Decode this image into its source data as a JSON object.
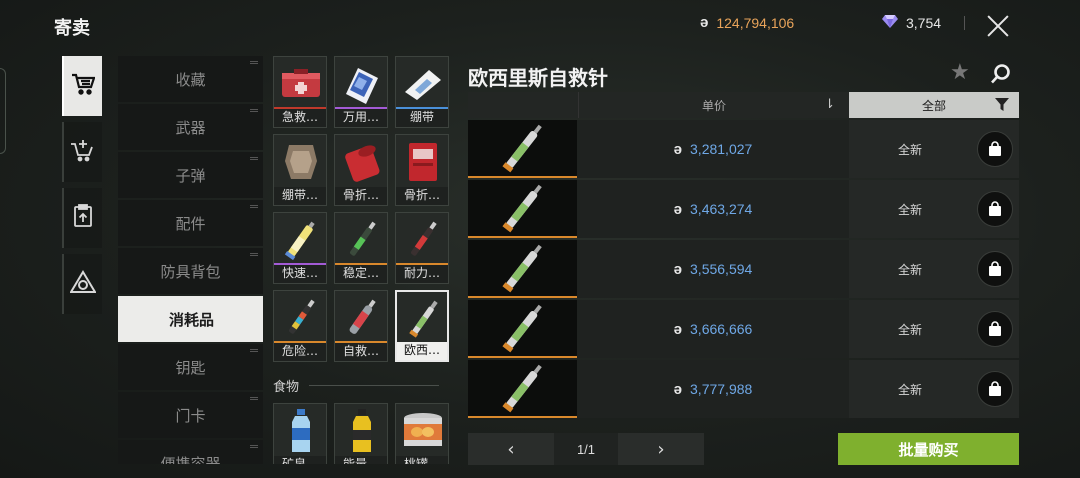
{
  "header": {
    "title": "寄卖",
    "koen_symbol": "ə",
    "koen_balance": "124,794,106",
    "gem_balance": "3,754"
  },
  "side_nav": {
    "icons": [
      "cart-icon",
      "cart-add-icon",
      "clipboard-upload-icon",
      "triangle-logo-icon"
    ],
    "active_index": 0
  },
  "categories": [
    {
      "label": "收藏"
    },
    {
      "label": "武器"
    },
    {
      "label": "子弹"
    },
    {
      "label": "配件"
    },
    {
      "label": "防具背包"
    },
    {
      "label": "消耗品"
    },
    {
      "label": "钥匙"
    },
    {
      "label": "门卡"
    },
    {
      "label": "便携容器"
    }
  ],
  "active_category": "消耗品",
  "medical_items": [
    {
      "label": "急救…",
      "icon": "red-medkit-icon",
      "bar": "#c0392b"
    },
    {
      "label": "万用…",
      "icon": "blue-pouch-icon",
      "bar": "#a35bd6"
    },
    {
      "label": "绷带",
      "icon": "white-bandage-icon",
      "bar": "#4a90d9"
    },
    {
      "label": "绷带…",
      "icon": "tan-bandage-icon",
      "bar": ""
    },
    {
      "label": "骨折…",
      "icon": "red-splint-roll-icon",
      "bar": ""
    },
    {
      "label": "骨折…",
      "icon": "red-splint-pack-icon",
      "bar": ""
    },
    {
      "label": "快速…",
      "icon": "yellow-syringe-icon",
      "bar": "#a35bd6"
    },
    {
      "label": "稳定…",
      "icon": "green-syringe-icon",
      "bar": "#d9882c"
    },
    {
      "label": "耐力…",
      "icon": "red-syringe-icon",
      "bar": "#d9882c"
    },
    {
      "label": "危险…",
      "icon": "multicolor-syringe-icon",
      "bar": "#d9882c"
    },
    {
      "label": "自救…",
      "icon": "red-tube-syringe-icon",
      "bar": "#d9882c"
    },
    {
      "label": "欧西…",
      "icon": "ossi-syringe-icon",
      "bar": ""
    }
  ],
  "selected_item_index": 11,
  "food_section": {
    "heading": "食物",
    "items": [
      {
        "label": "矿泉…",
        "icon": "water-bottle-icon"
      },
      {
        "label": "能量…",
        "icon": "energy-drink-icon"
      },
      {
        "label": "桃罐…",
        "icon": "peach-can-icon"
      }
    ]
  },
  "detail": {
    "title": "欧西里斯自救针",
    "price_header": "单价",
    "filter_label": "全部"
  },
  "listings": [
    {
      "price": "3,281,027",
      "condition": "全新"
    },
    {
      "price": "3,463,274",
      "condition": "全新"
    },
    {
      "price": "3,556,594",
      "condition": "全新"
    },
    {
      "price": "3,666,666",
      "condition": "全新"
    },
    {
      "price": "3,777,988",
      "condition": "全新"
    }
  ],
  "pagination": {
    "prev": "‹",
    "page": "1/1",
    "next": "›"
  },
  "bulk_buy_label": "批量购买",
  "colors": {
    "accent_green": "#7fb02e",
    "price_blue": "#6fa8e6",
    "koen_orange": "#e9a45a",
    "rarity_orange": "#d9882c"
  }
}
